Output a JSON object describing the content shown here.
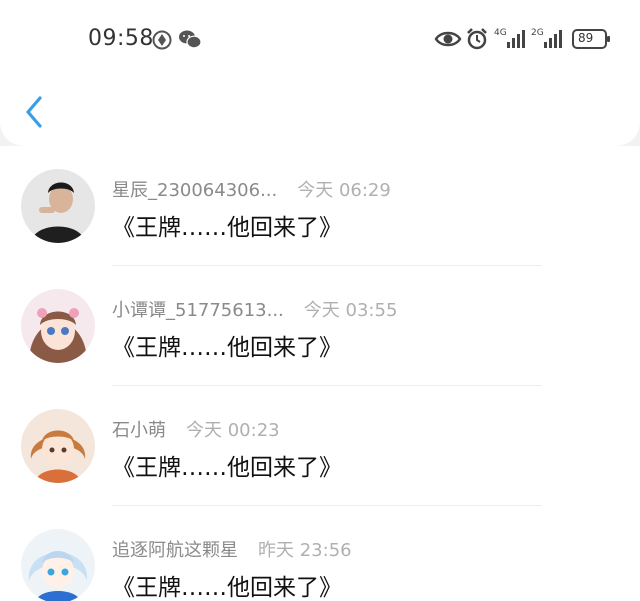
{
  "status_bar": {
    "time": "09:58",
    "network_1": "4G",
    "network_2": "2G",
    "battery": "89"
  },
  "comments": [
    {
      "user": "星辰_230064306...",
      "time": "今天 06:29",
      "text": "《王牌……他回来了》",
      "avatar": "boy-avatar"
    },
    {
      "user": "小谭谭_51775613...",
      "time": "今天 03:55",
      "text": "《王牌……他回来了》",
      "avatar": "anime-girl-avatar"
    },
    {
      "user": "石小萌",
      "time": "今天 00:23",
      "text": "《王牌……他回来了》",
      "avatar": "orange-hair-avatar"
    },
    {
      "user": "追逐阿航这颗星",
      "time": "昨天 23:56",
      "text": "《王牌……他回来了》",
      "avatar": "blue-hair-avatar"
    }
  ],
  "colors": {
    "accent": "#3a9de8",
    "background": "#f2f2f4"
  }
}
